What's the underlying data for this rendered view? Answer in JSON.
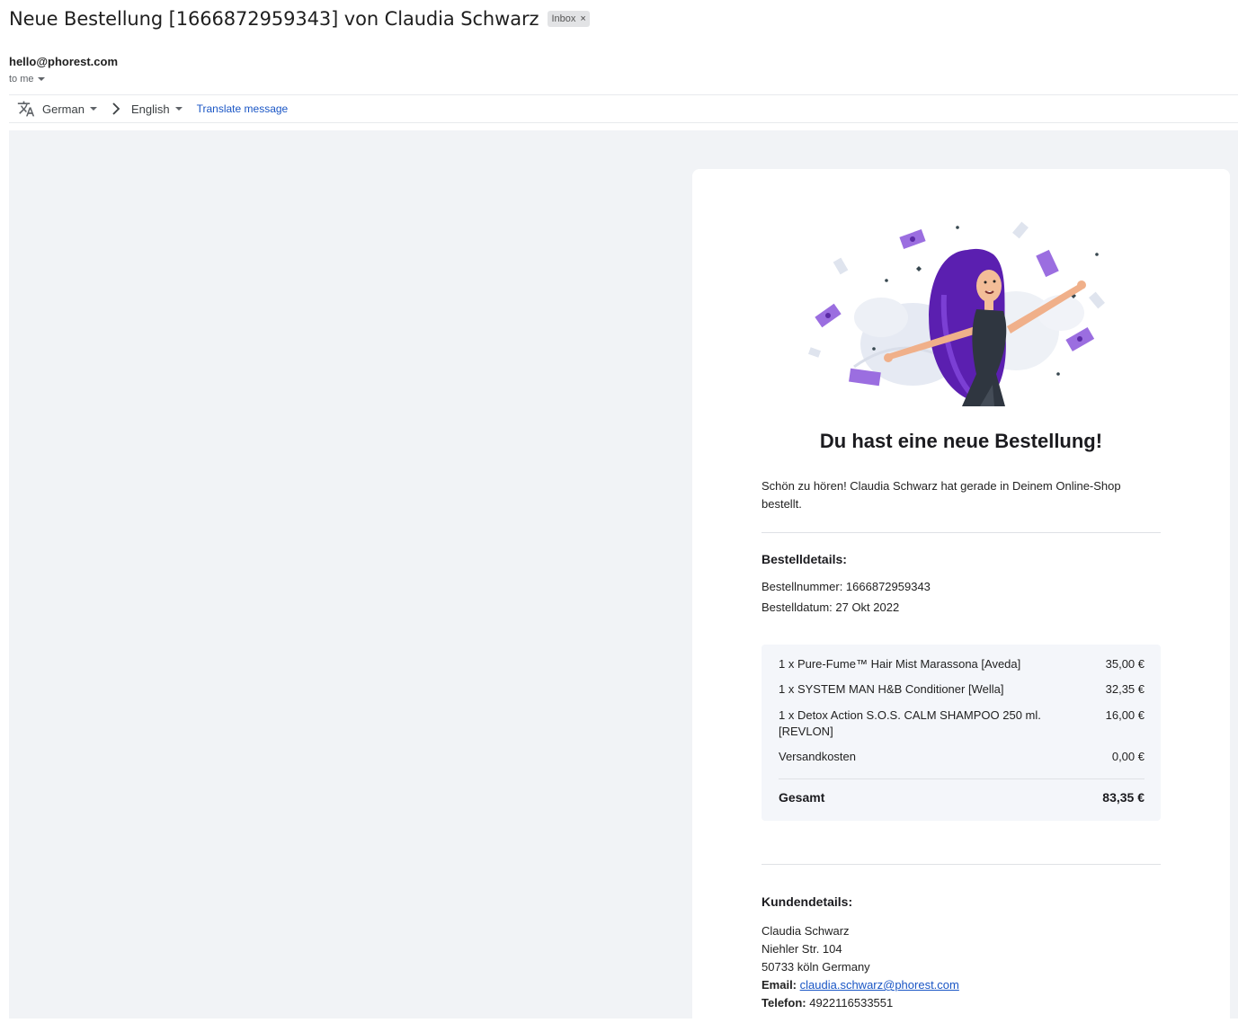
{
  "header": {
    "subject": "Neue Bestellung [1666872959343] von Claudia Schwarz",
    "label": "Inbox",
    "label_close": "×",
    "sender": "hello@phorest.com",
    "recipient": "to me"
  },
  "translate_bar": {
    "source_language": "German",
    "target_language": "English",
    "action": "Translate message"
  },
  "email": {
    "headline": "Du hast eine neue Bestellung!",
    "intro": "Schön zu hören! Claudia Schwarz hat gerade in Deinem Online-Shop bestellt.",
    "order_details": {
      "title": "Bestelldetails:",
      "order_number": "Bestellnummer: 1666872959343",
      "order_date": "Bestelldatum: 27 Okt 2022"
    },
    "items": [
      {
        "name": "1 x Pure-Fume™ Hair Mist Marassona [Aveda]",
        "price": "35,00 €"
      },
      {
        "name": "1 x SYSTEM MAN H&B Conditioner [Wella]",
        "price": "32,35 €"
      },
      {
        "name": "1 x Detox Action S.O.S. CALM SHAMPOO 250 ml. [REVLON]",
        "price": "16,00 €"
      },
      {
        "name": "Versandkosten",
        "price": "0,00 €"
      }
    ],
    "total": {
      "label": "Gesamt",
      "value": "83,35 €"
    },
    "customer": {
      "title": "Kundendetails:",
      "name": "Claudia Schwarz",
      "street": "Niehler Str. 104",
      "city": "50733 köln Germany",
      "email_label": "Email:",
      "email": "claudia.schwarz@phorest.com",
      "phone_label": "Telefon:",
      "phone": "4922116533551"
    }
  },
  "colors": {
    "accent_purple": "#7a3fd1",
    "link_blue": "#1a56c5",
    "email_background": "#f1f3f6"
  }
}
